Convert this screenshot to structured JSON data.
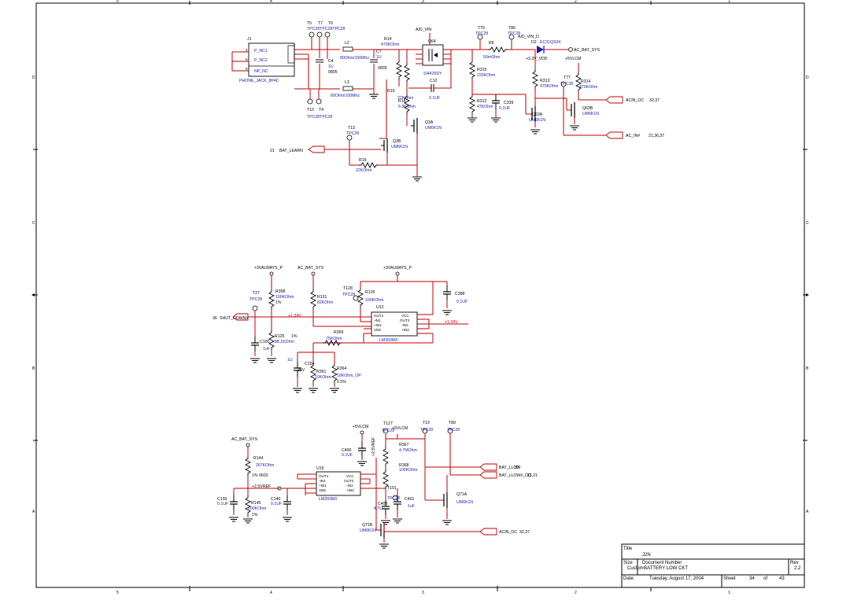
{
  "border_cols": [
    "5",
    "4",
    "3",
    "2",
    "1"
  ],
  "border_rows": [
    "D",
    "C",
    "B",
    "A"
  ],
  "colors": {
    "wire": "#c00000",
    "label": "#1a1aa8",
    "part": "#000000"
  },
  "title_block": {
    "title_label": "Title",
    "title": "J2N",
    "size_label": "Size",
    "size": "Custom",
    "docnum_label": "Document Number",
    "docnum": "BATTERY LOW CKT",
    "rev_label": "Rev",
    "rev": "2.2",
    "date_label": "Date:",
    "date": "Tuesday, August 17, 2004",
    "sheet_label": "Sheet",
    "sheet": "34",
    "of_label": "of",
    "total": "43"
  },
  "block_top": {
    "j1": "J1",
    "j1_pins": [
      "P_NC1",
      "P_NC2",
      "NP_NC"
    ],
    "j1_pin_nums": [
      "4",
      "5",
      "6"
    ],
    "j1_name": "PHONE_JACK_8P4C",
    "tp_top": [
      "T5",
      "T7",
      "T6"
    ],
    "tp_top_val": "TPC28TPC28TPC28",
    "tp_bot": [
      "T10",
      "T4"
    ],
    "tp_bot_val": "TPC28TPC28",
    "l2": "L2",
    "l2_val": "80Ohm/100Mhz",
    "l3": "L3",
    "l3_val": "80Ohm/100Mhz",
    "c4": "C4",
    "c4_val": "1U",
    "c4_tol": "0805",
    "c7": "C7",
    "c7_val": "1U",
    "c7_tol": "0805",
    "r14": "R14",
    "r14_val": "470KOhm",
    "r16": "R16",
    "r16_val": "22KOhm",
    "r18": "R18",
    "r18_val": "6.8KOhm",
    "c12": "C12",
    "c12_val": "0.1UF",
    "q64": "Q64",
    "q64_val": "SI4425DY",
    "a_d_vin": "A/D_VIN",
    "a_d_vin_d": "A/D_VIN_D",
    "t79": "T79",
    "t79_val": "TPC28",
    "t86": "T86",
    "t86_val": "TPC28",
    "r6": "R6",
    "r6_val": "50mOhm",
    "d2": "D2",
    "d2_val": "EC31QS04",
    "ac_bat_sys": "AC_BAT_SYS",
    "v3v3_vdd": "+3.3V_VDD",
    "v5vlcm": "+5VLCM",
    "r315": "R315",
    "r315_val": "220KOhm",
    "r312": "R312",
    "r312_val": "47KOhm",
    "c339": "C339",
    "c339_val": "0.1UF",
    "r313": "R313",
    "r313_val": "470KOhm",
    "t77": "T77",
    "t77_val": "TPC28",
    "r314": "R314",
    "r314_val": "470KOhm",
    "q63a": "Q63A",
    "q63a_val": "UM6K1N",
    "q63b": "Q63B",
    "q63b_val": "UM6K1N",
    "acin_oc": "ACIN_OC",
    "acin_oc_ref": "32,37",
    "ac_in": "AC_IN#",
    "ac_in_ref": "21,36,37",
    "q3a": "Q3A",
    "q3a_val": "UM6K1N",
    "q3b": "Q3B",
    "q3b_val": "UM6K1N",
    "t13": "T13",
    "t13_val": "TPC28",
    "bat_learn": "BAT_LEARN",
    "bat_learn_ref": "21",
    "r19": "R19",
    "r19_val": "22KOhm"
  },
  "block_mid": {
    "v3_always_p": "+3VALWAYS_P",
    "ac_bat_sys": "AC_BAT_SYS",
    "v3_always_p2": "+3VALWAYS_P",
    "t27": "T27",
    "t27_val": "TPC28",
    "r358": "R358",
    "r358_val": "100KOhm",
    "r358_tol": "1%",
    "r131": "R131",
    "r131_val": "82KOhm",
    "t128": "T128",
    "t128_val": "TPC28",
    "r126": "R126",
    "r126_val": "100KOhm",
    "u12": "U12",
    "u12_pins": [
      "OUT1",
      "-IN1",
      "+IN1",
      "VEE",
      "VCC",
      "OUT2",
      "-IN2",
      "+IN2"
    ],
    "u12_name": "LM393MX",
    "c388": "C388",
    "c388_val": "0.1UF",
    "shut_down": "SHUT_DOWN#",
    "shut_down_ref": "36",
    "v134_a": "+1.34V",
    "v134_b": "+1.34V",
    "r125": "R125",
    "r125_val": "88.1KOhm",
    "r125_tol": "1%",
    "c100": "C100",
    "c100_val": "1uF",
    "r359": "R359",
    "r359_val": "75KOhm",
    "c154": "C154",
    "c154_val": "1U",
    "c154_tol": "25V",
    "r361": "R361",
    "r361_val": "15KOhm",
    "r364": "R364",
    "r364_val": "18KOhm_OP",
    "r364_tol": "0.5%"
  },
  "block_bot": {
    "ac_bat_sys": "AC_BAT_SYS",
    "r144": "R144",
    "r144_val": "267KOhm",
    "r144_tol": "1% 0603",
    "u15": "U15",
    "u15_pins": [
      "OUT1",
      "-IN1",
      "+IN1",
      "VEE",
      "VCC",
      "OUT2",
      "-IN2",
      "+IN2"
    ],
    "u15_name": "LM393MX",
    "v25vref": "+2.5VREF",
    "v25vref_v": "+2.5VREF",
    "c139": "C139",
    "c139_val": "0.1UF",
    "r145": "R145",
    "r145_val": "100KOhm",
    "r145_tol": "1%",
    "c140": "C140",
    "c140_val": "0.1UF",
    "v5vlcm_a": "+5VLCM",
    "t127": "T127",
    "t127_val": "TPC28",
    "v5vlcm_b": "+5VLCM",
    "c400": "C400",
    "c400_val": "0.1UF",
    "r367": "R367",
    "r367_val": "4.7MOhm",
    "r368": "R368",
    "r368_val": "100KOhm",
    "t101": "T101",
    "t101_val": "TPC28",
    "c408": "C408",
    "c408_val": "4.7U",
    "c401": "C401",
    "c401_val": "1uF",
    "t19": "T19",
    "t19_val": "TPC28",
    "t89": "T89",
    "t89_val": "TPC28",
    "bat_llow": "BAT_LLOW",
    "bat_llow_ref": "37",
    "bat_llow_oc": "BAT_LLOW#_OC",
    "bat_llow_oc_ref": "15,21",
    "q71a": "Q71A",
    "q71a_val": "UM6K1N",
    "q71b": "Q71B",
    "q71b_val": "UM6K1N",
    "acin_oc": "ACIN_OC",
    "acin_oc_ref": "32,37"
  }
}
